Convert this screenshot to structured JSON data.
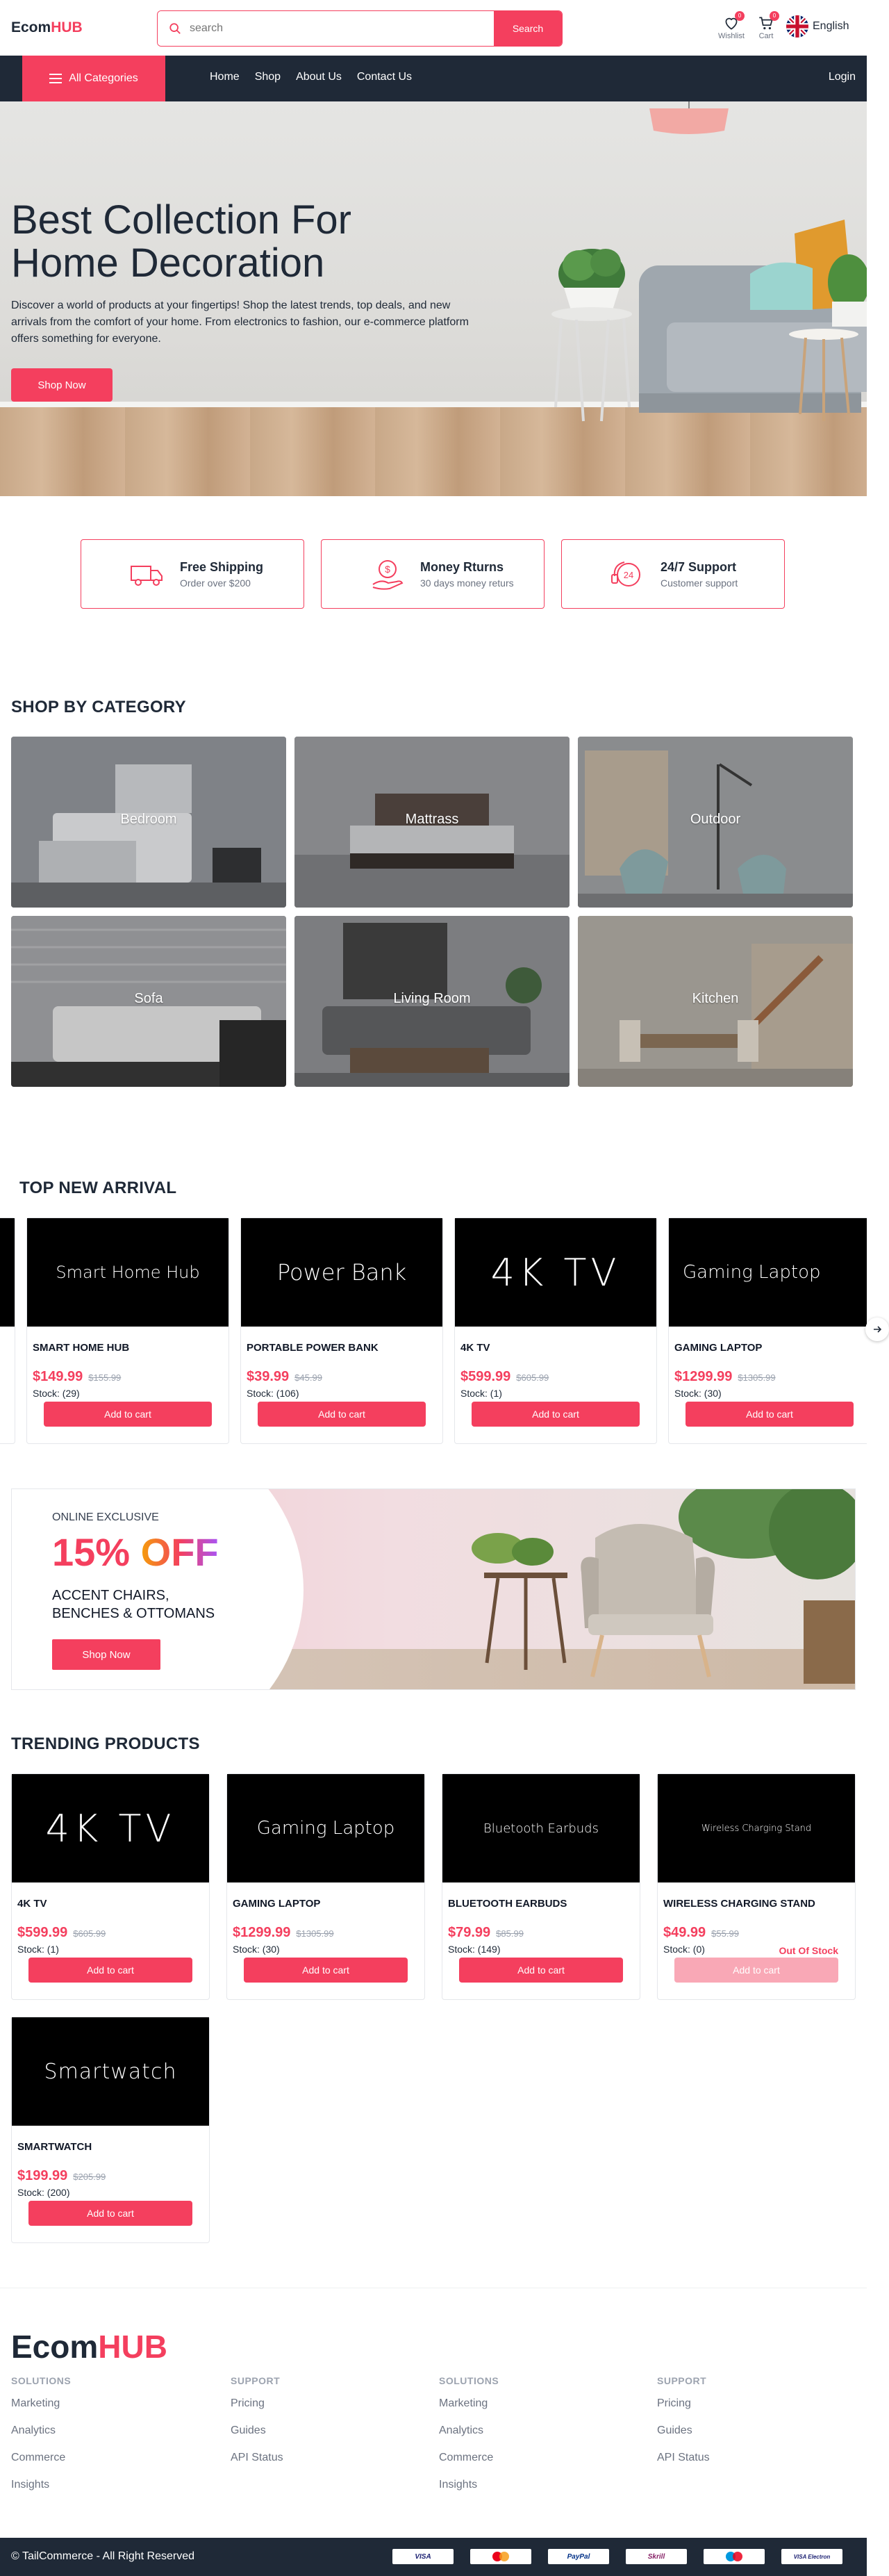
{
  "brand": {
    "logo_main": "Ecom",
    "logo_accent": "HUB"
  },
  "search": {
    "placeholder": "search",
    "button_label": "Search"
  },
  "header_icons": {
    "wishlist": {
      "label": "Wishlist",
      "count": "0"
    },
    "cart": {
      "label": "Cart",
      "count": "0"
    },
    "language": "English"
  },
  "nav": {
    "all_categories": "All Categories",
    "links": [
      "Home",
      "Shop",
      "About Us",
      "Contact Us"
    ],
    "login": "Login"
  },
  "hero": {
    "title_line1": "Best Collection For",
    "title_line2": "Home Decoration",
    "description": "Discover a world of products at your fingertips! Shop the latest trends, top deals, and new arrivals from the comfort of your home. From electronics to fashion, our e-commerce platform offers something for everyone.",
    "button_label": "Shop Now"
  },
  "features": [
    {
      "icon": "truck-icon",
      "title": "Free Shipping",
      "subtitle": "Order over $200"
    },
    {
      "icon": "money-return-icon",
      "title": "Money Rturns",
      "subtitle": "30 days money returs"
    },
    {
      "icon": "support-24-icon",
      "title": "24/7 Support",
      "subtitle": "Customer support"
    }
  ],
  "categories": {
    "title": "SHOP BY CATEGORY",
    "items": [
      "Bedroom",
      "Mattrass",
      "Outdoor",
      "Sofa",
      "Living Room",
      "Kitchen"
    ]
  },
  "new_arrivals": {
    "title": "TOP NEW ARRIVAL",
    "items": [
      {
        "image_text": "Smart Home Hub",
        "name": "SMART HOME HUB",
        "price": "$149.99",
        "old_price": "$155.99",
        "stock": "Stock: (29)",
        "button": "Add to cart"
      },
      {
        "image_text": "Power Bank",
        "name": "PORTABLE POWER BANK",
        "price": "$39.99",
        "old_price": "$45.99",
        "stock": "Stock: (106)",
        "button": "Add to cart"
      },
      {
        "image_text": "4K TV",
        "name": "4K TV",
        "price": "$599.99",
        "old_price": "$605.99",
        "stock": "Stock: (1)",
        "button": "Add to cart"
      },
      {
        "image_text": "Gaming Laptop",
        "name": "GAMING LAPTOP",
        "price": "$1299.99",
        "old_price": "$1305.99",
        "stock": "Stock: (30)",
        "button": "Add to cart"
      }
    ]
  },
  "promo": {
    "eyebrow": "ONLINE EXCLUSIVE",
    "percent": "15%",
    "off": "OFF",
    "line1": "ACCENT CHAIRS,",
    "line2": "BENCHES & OTTOMANS",
    "button": "Shop Now"
  },
  "trending": {
    "title": "TRENDING PRODUCTS",
    "items": [
      {
        "image_text": "4K TV",
        "name": "4K TV",
        "price": "$599.99",
        "old_price": "$605.99",
        "stock": "Stock: (1)",
        "button": "Add to cart",
        "status": ""
      },
      {
        "image_text": "Gaming Laptop",
        "name": "GAMING LAPTOP",
        "price": "$1299.99",
        "old_price": "$1305.99",
        "stock": "Stock: (30)",
        "button": "Add to cart",
        "status": ""
      },
      {
        "image_text": "Bluetooth Earbuds",
        "name": "BLUETOOTH EARBUDS",
        "price": "$79.99",
        "old_price": "$85.99",
        "stock": "Stock: (149)",
        "button": "Add to cart",
        "status": ""
      },
      {
        "image_text": "Wireless Charging Stand",
        "name": "WIRELESS CHARGING STAND",
        "price": "$49.99",
        "old_price": "$55.99",
        "stock": "Stock: (0)",
        "button": "Add to cart",
        "status": "Out Of Stock"
      },
      {
        "image_text": "Smartwatch",
        "name": "SMARTWATCH",
        "price": "$199.99",
        "old_price": "$205.99",
        "stock": "Stock: (200)",
        "button": "Add to cart",
        "status": ""
      }
    ]
  },
  "footer": {
    "logo_main": "Ecom",
    "logo_accent": "HUB",
    "columns": [
      {
        "heading": "SOLUTIONS",
        "links": [
          "Marketing",
          "Analytics",
          "Commerce",
          "Insights"
        ]
      },
      {
        "heading": "SUPPORT",
        "links": [
          "Pricing",
          "Guides",
          "API Status"
        ]
      },
      {
        "heading": "SOLUTIONS",
        "links": [
          "Marketing",
          "Analytics",
          "Commerce",
          "Insights"
        ]
      },
      {
        "heading": "SUPPORT",
        "links": [
          "Pricing",
          "Guides",
          "API Status"
        ]
      }
    ],
    "copyright": "© TailCommerce - All Right Reserved",
    "payments": [
      "VISA",
      "Mastercard",
      "PayPal",
      "Skrill",
      "Maestro",
      "VISA Electron"
    ]
  },
  "colors": {
    "accent": "#f43f5e",
    "dark": "#1f2937",
    "muted": "#6b7280"
  }
}
